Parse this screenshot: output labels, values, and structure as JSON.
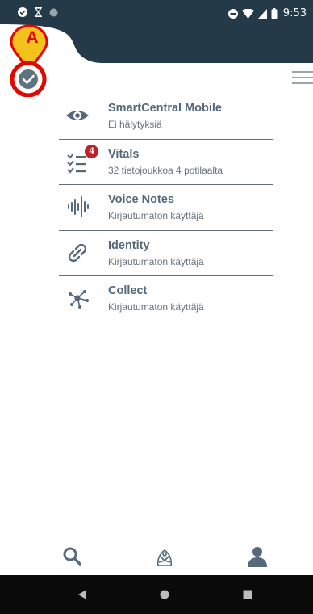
{
  "status_bar": {
    "time": "9:53",
    "left_icons": [
      "check-circle-icon",
      "hourglass-icon",
      "dot-icon"
    ],
    "right_icons": [
      "do-not-disturb-icon",
      "wifi-icon",
      "cell-signal-icon",
      "battery-icon"
    ]
  },
  "annotation": {
    "label": "A"
  },
  "apps": [
    {
      "name": "SmartCentral Mobile",
      "status": "Ei hälytyksiä",
      "icon": "eye-icon"
    },
    {
      "name": "Vitals",
      "status": "32 tietojoukkoa 4 potilaalta",
      "icon": "checklist-icon",
      "badge": "4"
    },
    {
      "name": "Voice Notes",
      "status": "Kirjautumaton käyttäjä",
      "icon": "audio-wave-icon"
    },
    {
      "name": "Identity",
      "status": "Kirjautumaton käyttäjä",
      "icon": "link-icon"
    },
    {
      "name": "Collect",
      "status": "Kirjautumaton käyttäjä",
      "icon": "network-nodes-icon"
    }
  ],
  "bottom_bar": [
    "search-icon",
    "patient-icon",
    "user-icon"
  ],
  "nav_bar": [
    "back-icon",
    "home-icon",
    "recents-icon"
  ],
  "colors": {
    "header": "#253a48",
    "accent": "#55697a",
    "badge": "#c0202a",
    "annotation": "#e10600",
    "marker_fill": "#f4c21a"
  }
}
